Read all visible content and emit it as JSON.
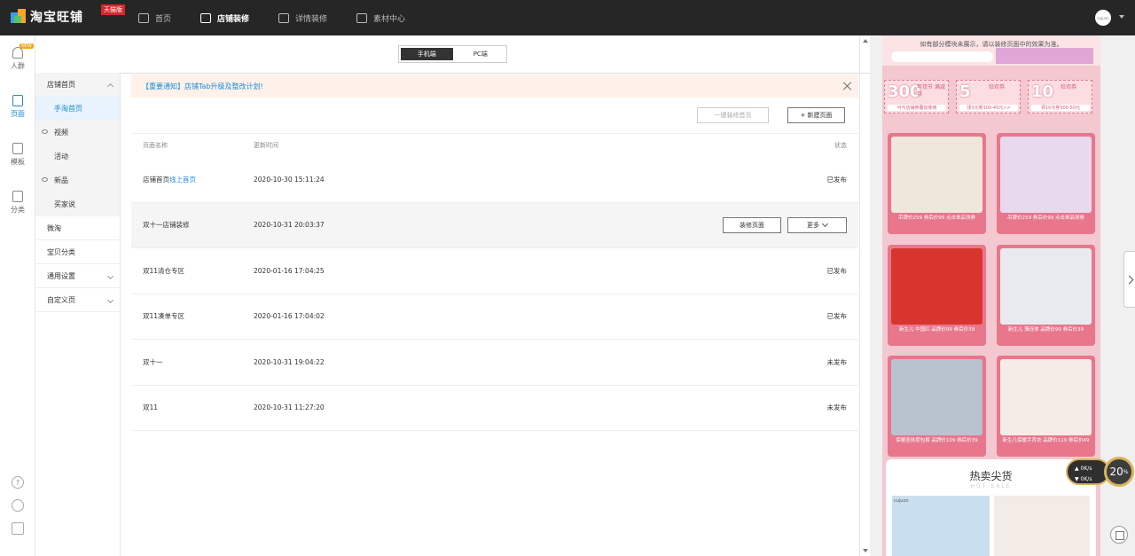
{
  "topbar": {
    "brand": "淘宝旺铺",
    "edition_badge": "天猫版",
    "nav": [
      {
        "label": "首页",
        "icon": "home-icon"
      },
      {
        "label": "店铺装修",
        "icon": "store-icon",
        "active": true
      },
      {
        "label": "详情装修",
        "icon": "detail-icon"
      },
      {
        "label": "素材中心",
        "icon": "folder-icon"
      }
    ],
    "avatar_text": "cujuon"
  },
  "rail": {
    "items": [
      {
        "label": "人群",
        "icon": "person-icon",
        "badge": "NEW"
      },
      {
        "label": "页面",
        "icon": "page-icon",
        "active": true
      },
      {
        "label": "模板",
        "icon": "template-icon"
      },
      {
        "label": "分类",
        "icon": "bag-icon"
      }
    ],
    "bottom_icons": [
      "help-icon",
      "headset-icon",
      "edit-icon"
    ]
  },
  "sidebar": {
    "items": [
      {
        "label": "店铺首页",
        "type": "group",
        "chevron": "up"
      },
      {
        "label": "手淘首页",
        "type": "sub",
        "active": true
      },
      {
        "label": "视频",
        "type": "group-hidden"
      },
      {
        "label": "活动",
        "type": "sub"
      },
      {
        "label": "新品",
        "type": "group-hidden"
      },
      {
        "label": "买家说",
        "type": "sub"
      },
      {
        "label": "微淘",
        "type": "plain"
      },
      {
        "label": "宝贝分类",
        "type": "plain"
      },
      {
        "label": "通用设置",
        "type": "plain",
        "chevron": "down"
      },
      {
        "label": "自定义页",
        "type": "plain",
        "chevron": "down"
      }
    ]
  },
  "device_toggle": {
    "mobile": "手机端",
    "pc": "PC端",
    "selected": "mobile"
  },
  "notice": {
    "text": "【重要通知】店铺Tab升级及整改计划!"
  },
  "toolbar": {
    "one_click_label": "一键装修首页",
    "new_page_label": "+ 新建页面"
  },
  "table": {
    "headers": {
      "name": "页面名称",
      "time": "更新时间",
      "status": "状态"
    },
    "rows": [
      {
        "name": "店铺首页",
        "link": "线上首页",
        "time": "2020-10-30 15:11:24",
        "status": "已发布"
      },
      {
        "name": "双十一店铺装修",
        "time": "2020-10-31 20:03:37",
        "status": "",
        "actions": [
          "装修页面",
          "更多"
        ]
      },
      {
        "name": "双11清仓专区",
        "time": "2020-01-16 17:04:25",
        "status": "已发布"
      },
      {
        "name": "双11凑单专区",
        "time": "2020-01-16 17:04:02",
        "status": "已发布"
      },
      {
        "name": "双十一",
        "time": "2020-10-31 19:04:22",
        "status": "未发布"
      },
      {
        "name": "双11",
        "time": "2020-10-31 11:27:20",
        "status": "未发布"
      }
    ]
  },
  "preview": {
    "note": "如有部分模块未展示，请以装修页面中的效果为准。",
    "coupons": [
      {
        "amount": "300",
        "label": "年货节 满减券",
        "desc": "可与店铺券叠加使用"
      },
      {
        "amount": "5",
        "label": "狂欢券",
        "desc": "领3元券300-45元>>"
      },
      {
        "amount": "10",
        "label": "狂欢券",
        "desc": "领10元券300-50元"
      }
    ],
    "products": [
      {
        "caption": "吊牌价259 券后价99  点击单品领券",
        "color": "#efe6dc"
      },
      {
        "caption": "吊牌价259 券后价99  点击单品领券",
        "color": "#e9d9ef"
      },
      {
        "caption": "新生儿 中国红 品牌价99 券后价39",
        "color": "#d9352f"
      },
      {
        "caption": "新生儿 薄连体 品牌价99 券后价39",
        "color": "#e8eaf0"
      },
      {
        "caption": "保暖连体荷包裤 品牌价109 券后价39",
        "color": "#b9c2cf"
      },
      {
        "caption": "新生儿保暖手背衣 品牌价119 券后价49",
        "color": "#f4ece6"
      }
    ],
    "hot_title": "热卖尖货",
    "hot_sub": "HOT SALE",
    "hot_brand": "cujuon"
  },
  "speed_widget": {
    "up": "0",
    "down": "0",
    "unit": "K/s",
    "percent": "20"
  }
}
